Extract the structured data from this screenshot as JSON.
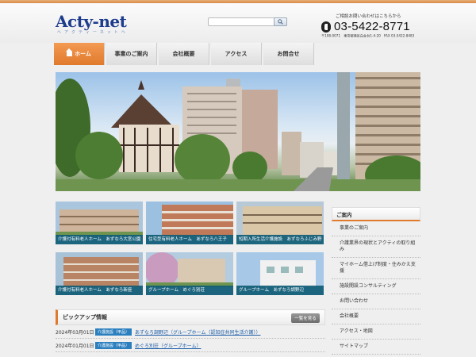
{
  "header": {
    "logo": "Acty-net",
    "logo_sub": "ヘ ア ク テ ィ ー ネ ッ ト ヘ",
    "search_placeholder": "",
    "contact_note": "ご相談お問い合わせはこちらから",
    "phone": "03-5422-8771",
    "address": "〒108-0071　東京都港区白金台1-4-20　FAX 03-5422-8483"
  },
  "nav": {
    "items": [
      {
        "label": "ホーム"
      },
      {
        "label": "事業のご案内"
      },
      {
        "label": "会社概要"
      },
      {
        "label": "アクセス"
      },
      {
        "label": "お問合せ"
      }
    ]
  },
  "thumbnails": [
    {
      "caption": "介護付有料老人ホーム　あずなろ大宮公園"
    },
    {
      "caption": "住宅型有料老人ホーム　あずなろ八王子"
    },
    {
      "caption": "短期入所生活介護施設　あずなろふじみ野"
    },
    {
      "caption": "介護付有料老人ホーム　あずなろ新座"
    },
    {
      "caption": "グループホーム　めぐろ別荘"
    },
    {
      "caption": "グループホーム　あずなろ調野辺"
    }
  ],
  "pickup": {
    "title": "ピックアップ情報",
    "more_label": "一覧を見る",
    "items": [
      {
        "date": "2024年03月01日",
        "badge": "介護施設（甲品）",
        "title": "あずなろ調野辺（グループホーム（認知症共同生活介護））"
      },
      {
        "date": "2024年01月01日",
        "badge": "介護施設（甲品）",
        "title": "めぐろ別荘（グループホーム）"
      }
    ]
  },
  "sidebar": {
    "title": "ご案内",
    "items": [
      {
        "label": "事業のご案内"
      },
      {
        "label": "介護業界の現状とアクティの取り組み"
      },
      {
        "label": "マイホーム借上げ制度・住みかえ支援"
      },
      {
        "label": "施設開設コンサルティング"
      },
      {
        "label": "お問い合わせ"
      },
      {
        "label": "会社概要"
      },
      {
        "label": "アクセス・地図"
      },
      {
        "label": "サイトマップ"
      }
    ]
  },
  "colors": {
    "accent": "#e07a2c",
    "brand": "#1e3c8c",
    "caption_bg": "#105c76",
    "link": "#2060a8"
  }
}
